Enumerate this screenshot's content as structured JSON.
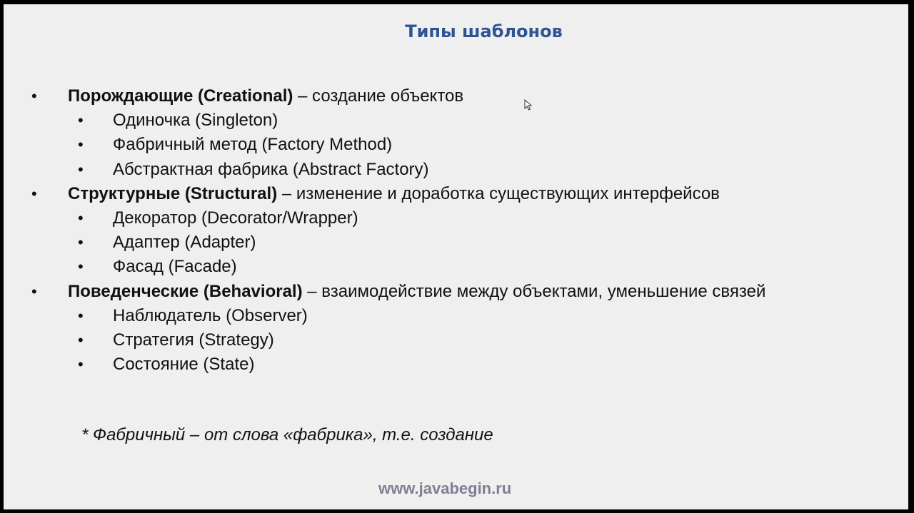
{
  "slide": {
    "title": "Типы шаблонов",
    "bullet_symbol": "•",
    "groups": [
      {
        "head": "Порождающие (Creational)",
        "desc": " – создание объектов",
        "items": [
          "Одиночка (Singleton)",
          "Фабричный метод (Factory Method)",
          "Абстрактная фабрика (Abstract Factory)"
        ]
      },
      {
        "head": "Структурные (Structural)",
        "desc": " – изменение и доработка существующих интерфейсов",
        "items": [
          "Декоратор (Decorator/Wrapper)",
          "Адаптер (Adapter)",
          "Фасад (Facade)"
        ]
      },
      {
        "head": "Поведенческие (Behavioral)",
        "desc": " – взаимодействие между объектами, уменьшение связей",
        "items": [
          "Наблюдатель (Observer)",
          "Стратегия (Strategy)",
          "Состояние (State)"
        ]
      }
    ],
    "note": "* Фабричный – от слова «фабрика», т.е. создание",
    "footer": "www.javabegin.ru",
    "colors": {
      "title": "#2f5496",
      "footer": "#7f7f93",
      "background": "#efefef",
      "frame": "#000000"
    },
    "icons": [
      "mouse-pointer-icon"
    ]
  }
}
